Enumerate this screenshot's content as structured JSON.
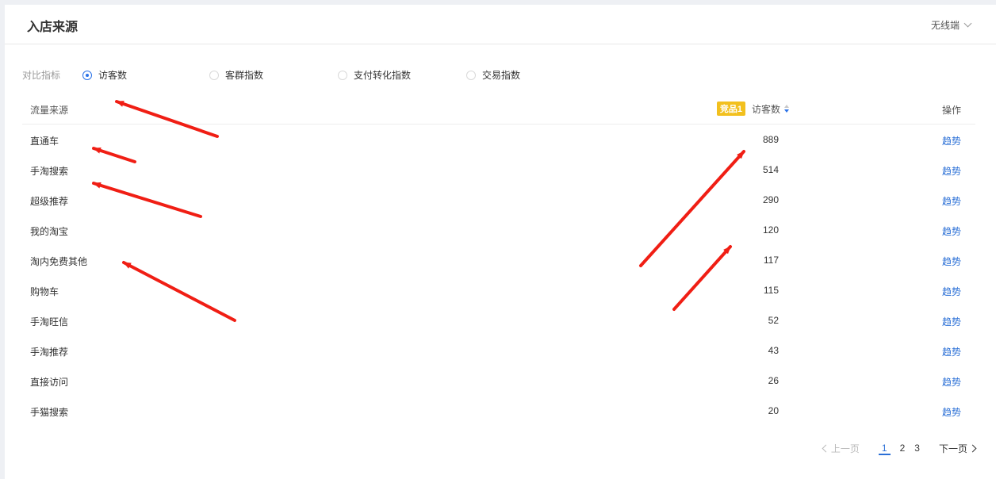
{
  "header": {
    "title": "入店来源",
    "terminal": "无线端"
  },
  "metrics": {
    "label": "对比指标",
    "options": [
      {
        "label": "访客数",
        "checked": true
      },
      {
        "label": "客群指数",
        "checked": false
      },
      {
        "label": "支付转化指数",
        "checked": false
      },
      {
        "label": "交易指数",
        "checked": false
      }
    ]
  },
  "table": {
    "headers": {
      "source": "流量来源",
      "badge": "竞品1",
      "visitors": "访客数",
      "action": "操作"
    },
    "rows": [
      {
        "source": "直通车",
        "value": "889",
        "action": "趋势"
      },
      {
        "source": "手淘搜索",
        "value": "514",
        "action": "趋势"
      },
      {
        "source": "超级推荐",
        "value": "290",
        "action": "趋势"
      },
      {
        "source": "我的淘宝",
        "value": "120",
        "action": "趋势"
      },
      {
        "source": "淘内免费其他",
        "value": "117",
        "action": "趋势"
      },
      {
        "source": "购物车",
        "value": "115",
        "action": "趋势"
      },
      {
        "source": "手淘旺信",
        "value": "52",
        "action": "趋势"
      },
      {
        "source": "手淘推荐",
        "value": "43",
        "action": "趋势"
      },
      {
        "source": "直接访问",
        "value": "26",
        "action": "趋势"
      },
      {
        "source": "手猫搜索",
        "value": "20",
        "action": "趋势"
      }
    ]
  },
  "pagination": {
    "prev": "上一页",
    "pages": [
      "1",
      "2",
      "3"
    ],
    "current": "1",
    "next": "下一页"
  },
  "colors": {
    "accent": "#2a72e8",
    "link": "#2a6fd6",
    "badge": "#f2c01e",
    "annotation": "#f01e14"
  }
}
